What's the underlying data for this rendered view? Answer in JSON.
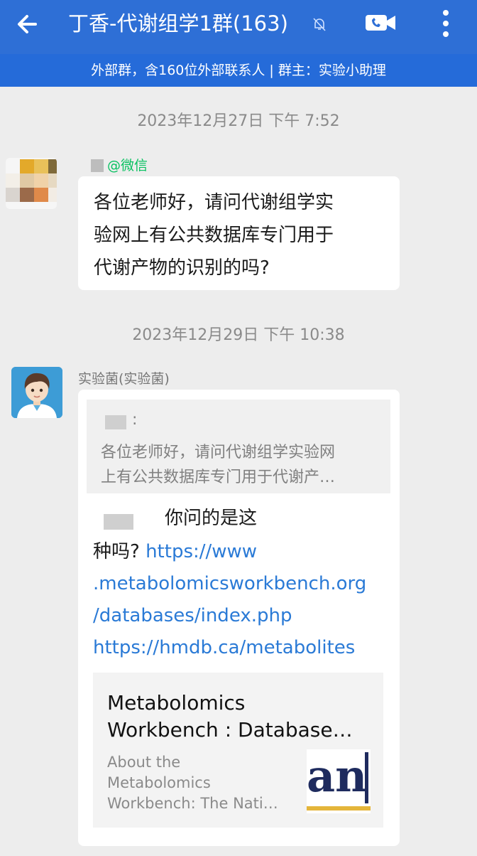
{
  "header": {
    "title": "丁香-代谢组学1群(163)",
    "subtitle": "外部群，含160位外部联系人 | 群主：实验小助理"
  },
  "messages": [
    {
      "timestamp": "2023年12月27日  下午 7:52",
      "sender_tag": "@微信",
      "text_lines": [
        "各位老师好，请问代谢组学实",
        "验网上有公共数据库专门用于",
        "代谢产物的识别的吗?"
      ]
    },
    {
      "timestamp": "2023年12月29日  下午 10:38",
      "sender_name": "实验菌(实验菌)",
      "quote": {
        "author_suffix": ":",
        "line1": "各位老师好，请问代谢组学实验网",
        "line2": "上有公共数据库专门用于代谢产…"
      },
      "reply_line1": "你问的是这",
      "reply_line2_prefix": "种吗?",
      "link1_part1": "https://www",
      "link1_part2": ".metabolomicsworkbench.org",
      "link1_part3": "/databases/index.php",
      "link2": "https://hmdb.ca/metabolites",
      "card": {
        "title_line1": "Metabolomics",
        "title_line2": "Workbench : Database…",
        "desc_line1": "About the",
        "desc_line2": "Metabolomics",
        "desc_line3": "Workbench: The Nati…",
        "thumb_text": "an"
      }
    }
  ],
  "colors": {
    "header": "#2e6fd6",
    "link": "#2a7ad6",
    "tag_green": "#07c160"
  }
}
